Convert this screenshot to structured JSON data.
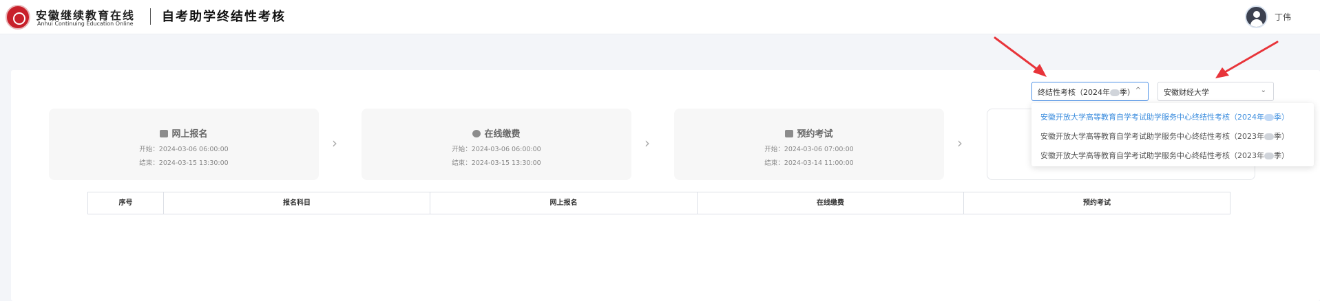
{
  "header": {
    "brand_cn": "安徽继续教育在线",
    "brand_en": "Anhui Continuing Education  Online",
    "title": "自考助学终结性考核",
    "user_name": "丁伟"
  },
  "filters": {
    "term_select_value": "终结性考核（2024年",
    "term_select_suffix": "季）",
    "school_select_value": "安徽财经大学",
    "term_options": [
      {
        "label": "安徽开放大学高等教育自学考试助学服务中心终结性考核（2024年",
        "suffix": "季）",
        "selected": true
      },
      {
        "label": "安徽开放大学高等教育自学考试助学服务中心终结性考核（2023年",
        "suffix": "季）",
        "selected": false
      },
      {
        "label": "安徽开放大学高等教育自学考试助学服务中心终结性考核（2023年",
        "suffix": "季）",
        "selected": false
      }
    ]
  },
  "steps": [
    {
      "title": "网上报名",
      "icon": "monitor-icon",
      "start": "开始：2024-03-06 06:00:00",
      "end": "结束：2024-03-15 13:30:00"
    },
    {
      "title": "在线缴费",
      "icon": "payment-icon",
      "start": "开始：2024-03-06 06:00:00",
      "end": "结束：2024-03-15 13:30:00"
    },
    {
      "title": "预约考试",
      "icon": "calendar-icon",
      "start": "开始：2024-03-06 07:00:00",
      "end": "结束：2024-03-14 11:00:00"
    }
  ],
  "step_separator": "›",
  "table": {
    "headers": [
      "序号",
      "报名科目",
      "网上报名",
      "在线缴费",
      "预约考试"
    ]
  },
  "colors": {
    "accent": "#3c8dde",
    "annotation_arrow": "#e8343a",
    "logo": "#c8202a"
  }
}
